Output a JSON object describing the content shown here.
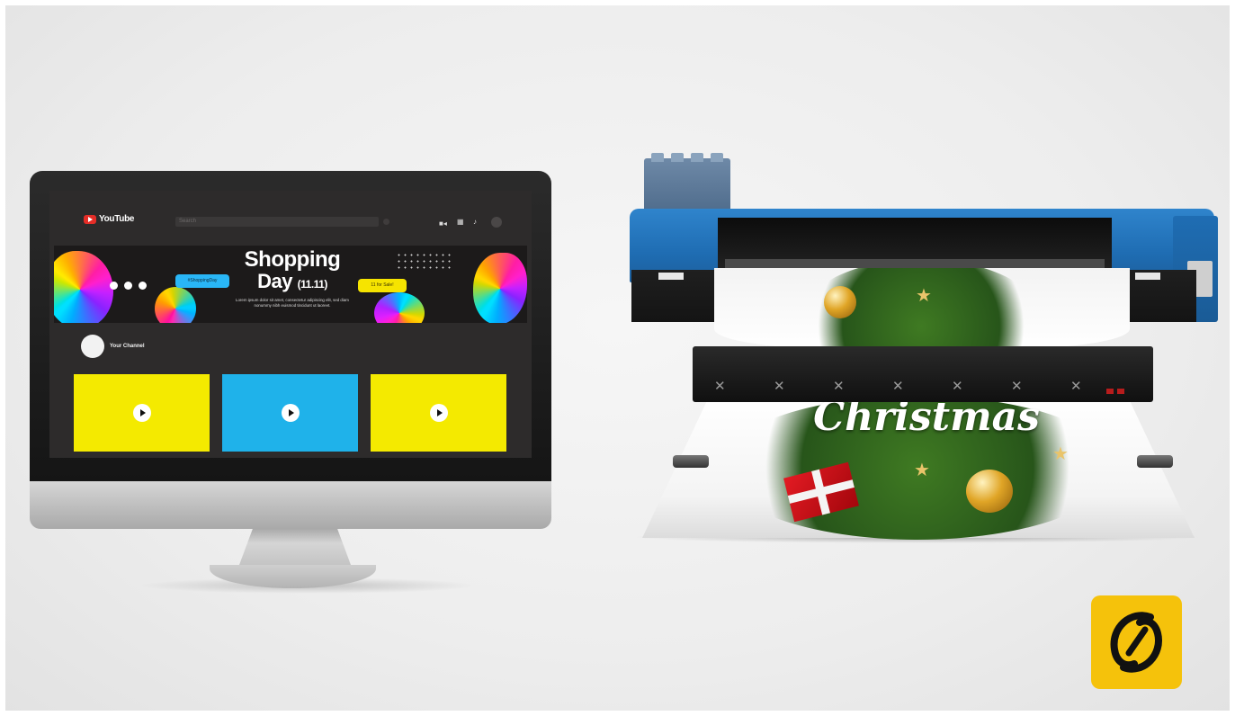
{
  "screen": {
    "app_name": "YouTube",
    "search_placeholder": "Search",
    "banner": {
      "title_line1": "Shopping",
      "title_line2": "Day",
      "title_date": "(11.11)",
      "subtitle": "Lorem ipsum dolor sit amet, consectetur adipiscing elit, sed diam nonummy nibh euismod tincidunt ut laoreet.",
      "bubble_blue": "#ShoppingDay",
      "bubble_yellow": "11 for Sale!"
    },
    "channel_name": "Your Channel",
    "thumbnail_colors": [
      "#f4ea00",
      "#1fb2ea",
      "#f4ea00"
    ]
  },
  "printout": {
    "text": "Christmas"
  },
  "icons": {
    "youtube": "youtube-logo-icon",
    "camera": "video-camera-icon",
    "apps": "apps-grid-icon",
    "bell": "bell-icon",
    "play": "play-icon",
    "brand": "brand-logo-icon"
  },
  "colors": {
    "printer_blue": "#1f6db3",
    "brand_yellow": "#f5c20b",
    "screen_bg": "#2d2b2b"
  }
}
